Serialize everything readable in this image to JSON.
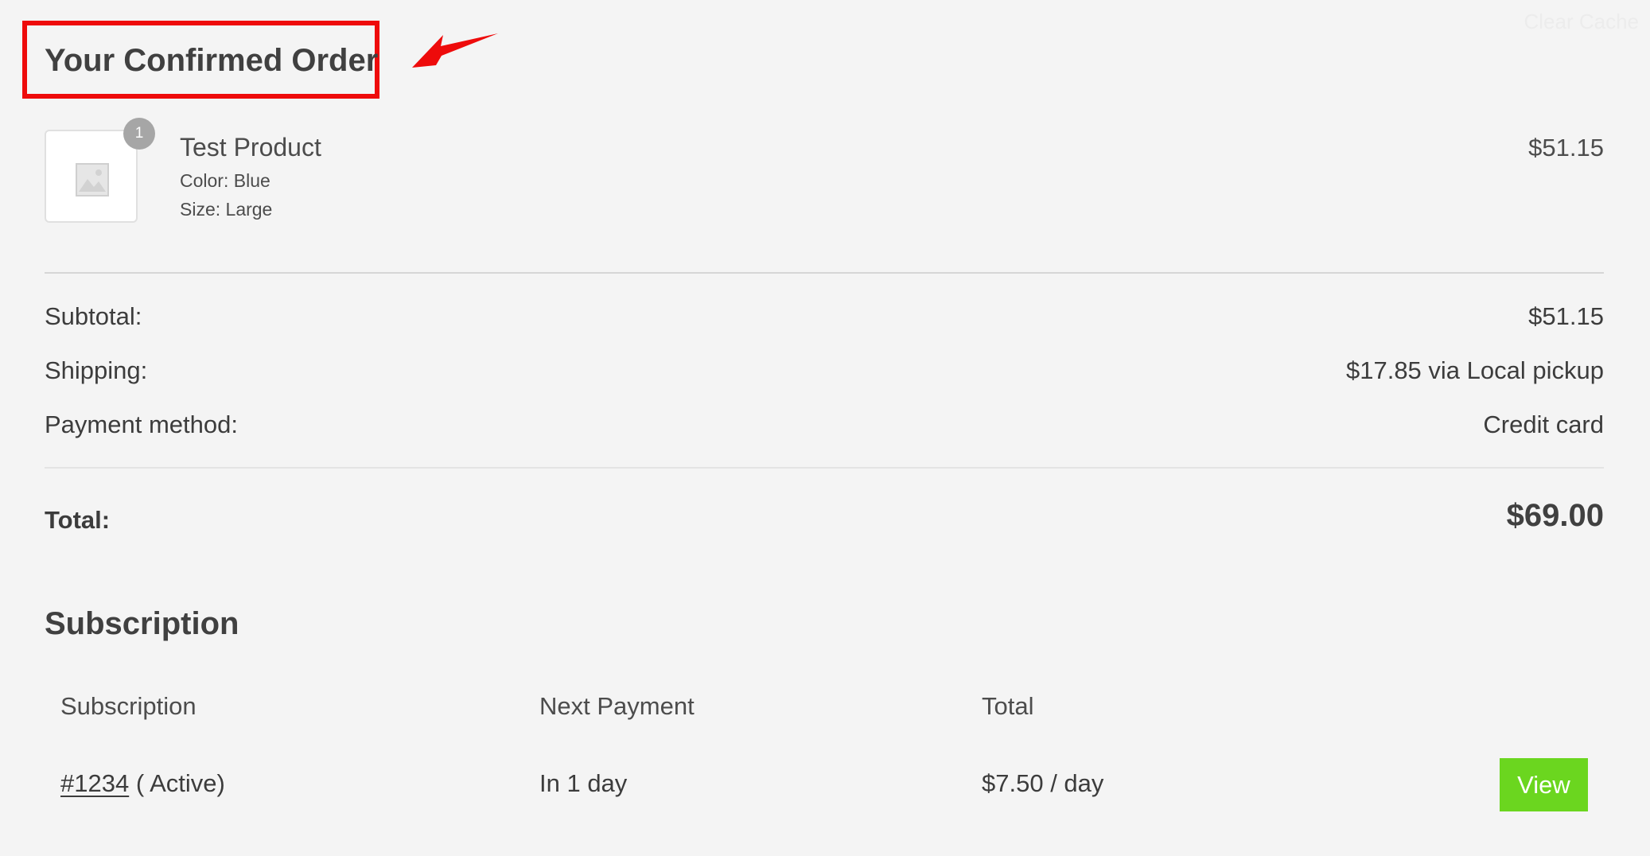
{
  "header": {
    "clear_cache_label": "Clear Cache",
    "title": "Your Confirmed Order"
  },
  "annotation": {
    "color": "#ee0b0b"
  },
  "product": {
    "quantity": "1",
    "name": "Test Product",
    "attributes": [
      "Color: Blue",
      "Size: Large"
    ],
    "price": "$51.15",
    "image_icon": "image-placeholder-icon"
  },
  "summary": {
    "rows": [
      {
        "label": "Subtotal:",
        "value": "$51.15"
      },
      {
        "label": "Shipping:",
        "value": "$17.85 via Local pickup"
      },
      {
        "label": "Payment method:",
        "value": "Credit card"
      }
    ],
    "total_label": "Total:",
    "total_value": "$69.00"
  },
  "subscription": {
    "heading": "Subscription",
    "columns": [
      "Subscription",
      "Next Payment",
      "Total"
    ],
    "rows": [
      {
        "id": "#1234",
        "status": "( Active)",
        "next_payment": "In 1 day",
        "total": "$7.50 / day",
        "action_label": "View"
      }
    ]
  },
  "colors": {
    "background": "#f4f4f4",
    "accent_button": "#6bd61f",
    "highlight": "#ee0b0b"
  }
}
